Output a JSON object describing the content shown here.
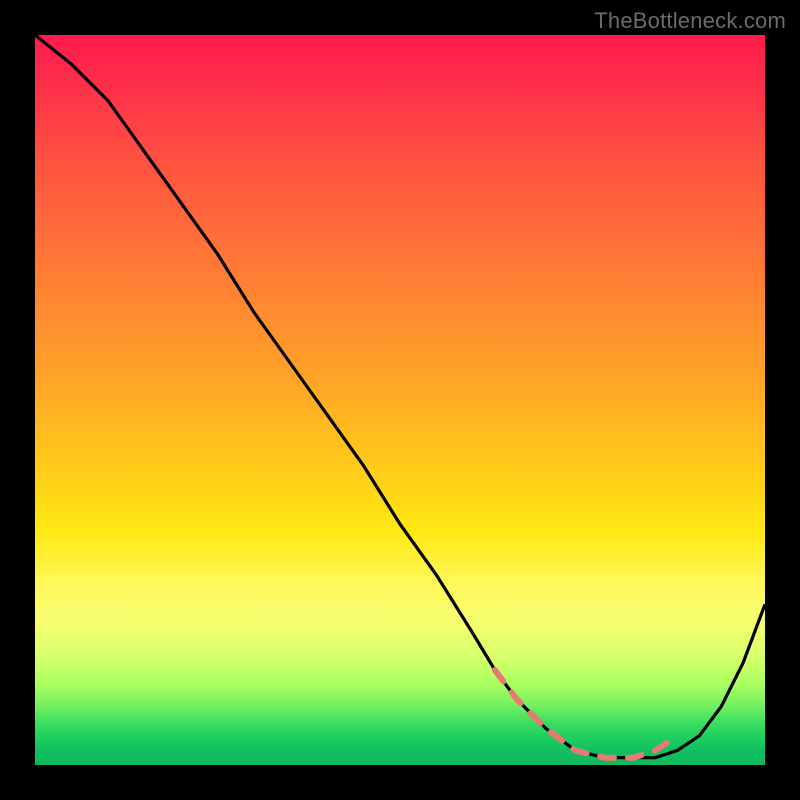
{
  "watermark": "TheBottleneck.com",
  "colors": {
    "background": "#000000",
    "curve": "#000000",
    "dash": "#e77a72",
    "gradient_top": "#ff1a4d",
    "gradient_bottom": "#0fb85e"
  },
  "chart_data": {
    "type": "line",
    "title": "",
    "xlabel": "",
    "ylabel": "",
    "xlim": [
      0,
      100
    ],
    "ylim": [
      0,
      100
    ],
    "grid": false,
    "legend": false,
    "series": [
      {
        "name": "curve",
        "x": [
          0,
          5,
          10,
          15,
          20,
          25,
          30,
          35,
          40,
          45,
          50,
          55,
          60,
          63,
          66,
          70,
          74,
          78,
          82,
          85,
          88,
          91,
          94,
          97,
          100
        ],
        "y": [
          100,
          96,
          91,
          84,
          77,
          70,
          62,
          55,
          48,
          41,
          33,
          26,
          18,
          13,
          9,
          5,
          2,
          1,
          1,
          1,
          2,
          4,
          8,
          14,
          22
        ]
      }
    ],
    "dashed_segment": {
      "name": "highlight",
      "x": [
        63,
        66,
        70,
        74,
        78,
        82,
        85,
        88
      ],
      "y": [
        13,
        9,
        5,
        2,
        1,
        1,
        2,
        4
      ]
    }
  }
}
